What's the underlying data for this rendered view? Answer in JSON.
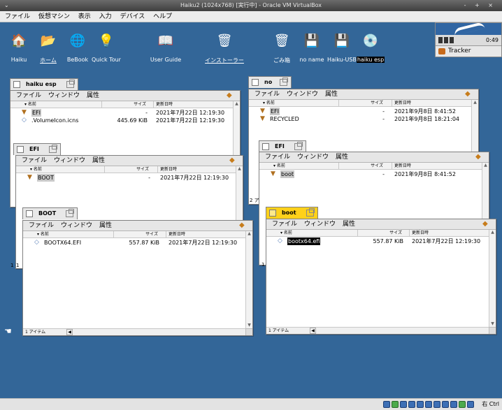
{
  "titlebar": {
    "title": "Haiku2 (1024x768) [実行中] - Oracle VM VirtualBox",
    "left_icon": "chevron-down-icon",
    "controls": "- + ×"
  },
  "menubar": [
    "ファイル",
    "仮想マシン",
    "表示",
    "入力",
    "デバイス",
    "ヘルプ"
  ],
  "desktop_icons": [
    {
      "label": "Haiku",
      "icon": "home-icon",
      "glyph": "🏠"
    },
    {
      "label": "ホーム",
      "icon": "home-folder-icon",
      "glyph": "📂",
      "underline": true
    },
    {
      "label": "BeBook",
      "icon": "bebook-icon",
      "glyph": "🌐"
    },
    {
      "label": "Quick Tour",
      "icon": "quicktour-icon",
      "glyph": "💡"
    },
    {
      "label": "User Guide",
      "icon": "user-guide-icon",
      "glyph": "📖"
    },
    {
      "label": "インストーラー",
      "icon": "installer-icon",
      "glyph": "🗑",
      "underline": true
    },
    {
      "label": "ごみ箱",
      "icon": "trash-icon",
      "glyph": "🗑"
    },
    {
      "label": "no name",
      "icon": "disk-icon",
      "glyph": "💾"
    },
    {
      "label": "Haiku-USB",
      "icon": "usb-disk-icon",
      "glyph": "💾"
    },
    {
      "label": "haiku esp",
      "icon": "cd-icon",
      "glyph": "💿",
      "selected": true
    }
  ],
  "deskbar": {
    "clock": "0:49",
    "tracker": "Tracker"
  },
  "left_windows": [
    {
      "tab": "haiku esp",
      "menu": [
        "ファイル",
        "ウィンドウ",
        "属性"
      ],
      "columns": {
        "name": "名前",
        "size": "サイズ",
        "date": "更新日時"
      },
      "rows": [
        {
          "name": "EFI",
          "size": "-",
          "date": "2021年7月22日 12:19:30",
          "kind": "folder",
          "hl": true
        },
        {
          "name": ".VolumeIcon.icns",
          "size": "445.69 KiB",
          "date": "2021年7月22日 12:19:30",
          "kind": "file"
        }
      ]
    },
    {
      "tab": "EFI",
      "menu": [
        "ファイル",
        "ウィンドウ",
        "属性"
      ],
      "columns": {
        "name": "名前",
        "size": "サイズ",
        "date": "更新日時"
      },
      "rows": [
        {
          "name": "BOOT",
          "size": "-",
          "date": "2021年7月22日 12:19:30",
          "kind": "folder",
          "hl": true
        }
      ]
    },
    {
      "tab": "BOOT",
      "menu": [
        "ファイル",
        "ウィンドウ",
        "属性"
      ],
      "columns": {
        "name": "名前",
        "size": "サイズ",
        "date": "更新日時"
      },
      "rows": [
        {
          "name": "BOOTX64.EFI",
          "size": "557.87 KiB",
          "date": "2021年7月22日 12:19:30",
          "kind": "file"
        }
      ],
      "status": "1 アイテム"
    }
  ],
  "right_windows": [
    {
      "tab": "no name",
      "menu": [
        "ファイル",
        "ウィンドウ",
        "属性"
      ],
      "columns": {
        "name": "名前",
        "size": "サイズ",
        "date": "更新日時"
      },
      "rows": [
        {
          "name": "EFI",
          "size": "-",
          "date": "2021年9月8日 8:41:52",
          "kind": "folder",
          "hl": true
        },
        {
          "name": "RECYCLED",
          "size": "-",
          "date": "2021年9月8日 18:21:04",
          "kind": "folder"
        }
      ]
    },
    {
      "tab": "EFI",
      "menu": [
        "ファイル",
        "ウィンドウ",
        "属性"
      ],
      "columns": {
        "name": "名前",
        "size": "サイズ",
        "date": "更新日時"
      },
      "rows": [
        {
          "name": "boot",
          "size": "-",
          "date": "2021年9月8日 8:41:52",
          "kind": "folder",
          "hl": true
        }
      ]
    },
    {
      "tab": "boot",
      "active": true,
      "menu": [
        "ファイル",
        "ウィンドウ",
        "属性"
      ],
      "columns": {
        "name": "名前",
        "size": "サイズ",
        "date": "更新日時"
      },
      "rows": [
        {
          "name": "bootx64.efi",
          "size": "557.87 KiB",
          "date": "2021年7月22日 12:19:30",
          "kind": "file",
          "sel": true
        }
      ],
      "status": "1 アイテム"
    }
  ],
  "side_fragments": {
    "left_a": "1",
    "left_b": "1",
    "right_a": "2 ア",
    "right_b": "1"
  },
  "statusbar": {
    "host_key": "右 Ctrl"
  },
  "colors": {
    "desktop": "#336698",
    "active_tab": "#ffd11a",
    "tab": "#e8e8e8"
  }
}
